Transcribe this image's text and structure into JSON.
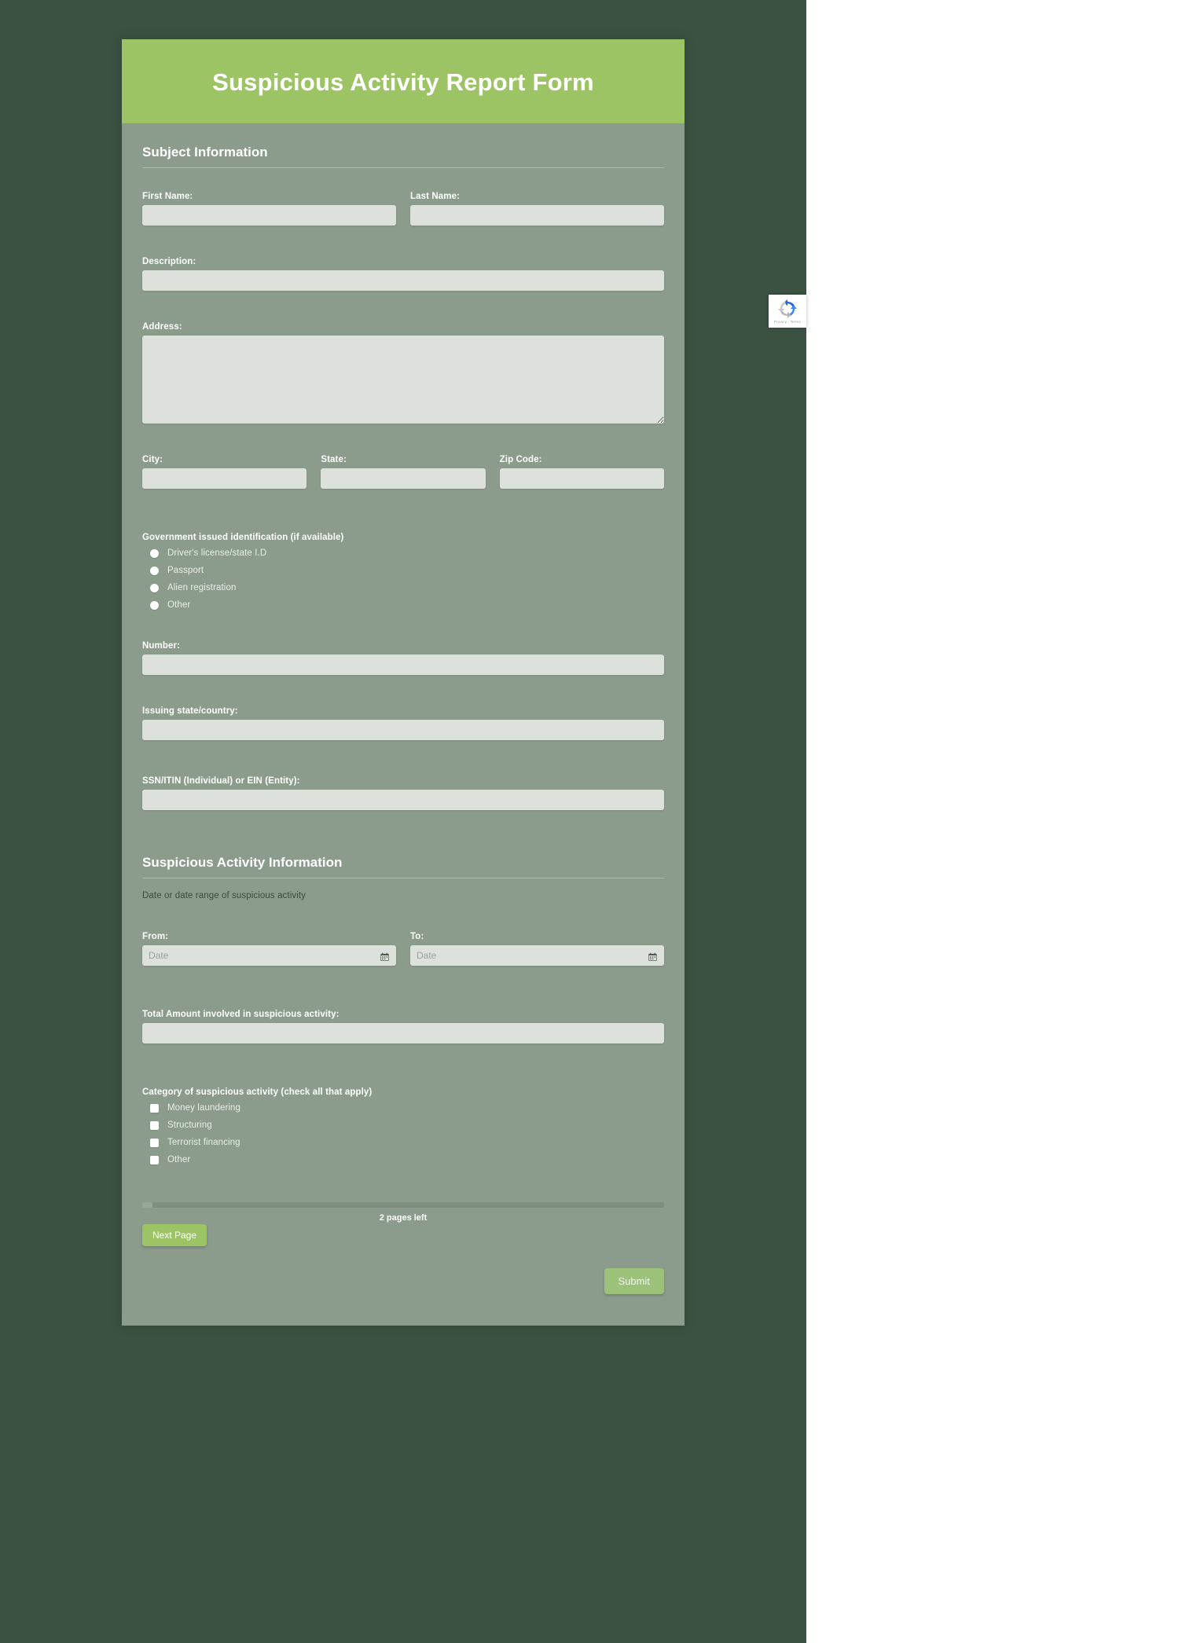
{
  "header": {
    "title": "Suspicious Activity Report Form"
  },
  "sections": {
    "subject": {
      "heading": "Subject Information",
      "first_name_label": "First Name:",
      "first_name_value": "",
      "last_name_label": "Last Name:",
      "last_name_value": "",
      "description_label": "Description:",
      "description_value": "",
      "address_label": "Address:",
      "address_value": "",
      "city_label": "City:",
      "city_value": "",
      "state_label": "State:",
      "state_value": "",
      "zip_label": "Zip Code:",
      "zip_value": "",
      "gov_id_label": "Government issued identification (if available)",
      "gov_id_options": [
        "Driver's license/state I.D",
        "Passport",
        "Alien registration",
        "Other"
      ],
      "number_label": "Number:",
      "number_value": "",
      "issuing_label": "Issuing state/country:",
      "issuing_value": "",
      "ssn_label": "SSN/ITIN (Individual) or EIN (Entity):",
      "ssn_value": ""
    },
    "activity": {
      "heading": "Suspicious Activity Information",
      "date_note": "Date or date range of suspicious activity",
      "from_label": "From:",
      "from_placeholder": "Date",
      "from_value": "",
      "to_label": "To:",
      "to_placeholder": "Date",
      "to_value": "",
      "total_amount_label": "Total Amount involved in suspicious activity:",
      "total_amount_value": "",
      "category_label": "Category of suspicious activity (check all that apply)",
      "category_options": [
        "Money laundering",
        "Structuring",
        "Terrorist financing",
        "Other"
      ]
    }
  },
  "footer": {
    "pages_left": "2 pages left",
    "next_page_label": "Next Page",
    "submit_label": "Submit",
    "progress_percent": 2
  },
  "recaptcha": {
    "privacy_terms": "Privacy - Terms"
  },
  "colors": {
    "page_background": "#3b5242",
    "header_green": "#9cc464",
    "form_background": "#8b9c8c",
    "input_background": "#dce1dc",
    "button_green": "#9cc464",
    "submit_green": "#9cc179"
  }
}
